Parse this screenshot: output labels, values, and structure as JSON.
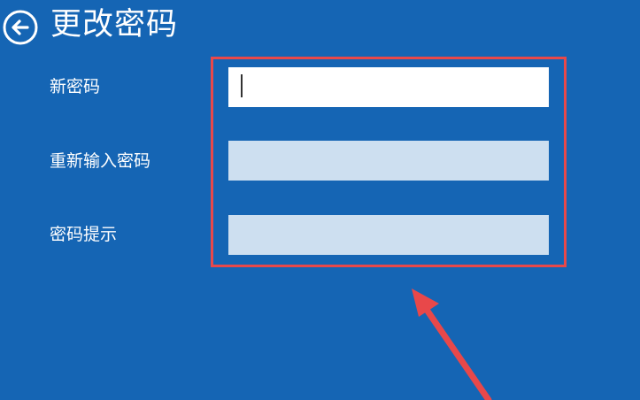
{
  "header": {
    "title": "更改密码",
    "back_icon": "back-arrow-circle-icon"
  },
  "form": {
    "fields": [
      {
        "label": "新密码",
        "value": "",
        "state": "focused"
      },
      {
        "label": "重新输入密码",
        "value": "",
        "state": "inactive"
      },
      {
        "label": "密码提示",
        "value": "",
        "state": "inactive"
      }
    ]
  },
  "colors": {
    "background": "#1565b4",
    "text": "#ffffff",
    "active_input": "#ffffff",
    "inactive_input": "#cddff0",
    "annotation_red": "#e8484a"
  },
  "annotation": {
    "highlight_box_icon": "red-rectangle-highlight",
    "arrow_icon": "red-arrow-icon"
  }
}
